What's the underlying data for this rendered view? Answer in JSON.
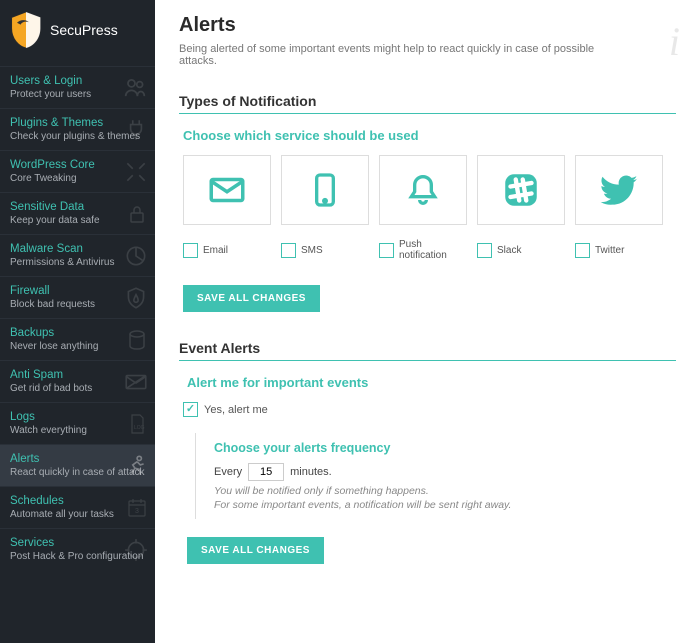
{
  "brand": "SecuPress",
  "sidebar": {
    "items": [
      {
        "title": "Users & Login",
        "sub": "Protect your users"
      },
      {
        "title": "Plugins & Themes",
        "sub": "Check your plugins & themes"
      },
      {
        "title": "WordPress Core",
        "sub": "Core Tweaking"
      },
      {
        "title": "Sensitive Data",
        "sub": "Keep your data safe"
      },
      {
        "title": "Malware Scan",
        "sub": "Permissions & Antivirus"
      },
      {
        "title": "Firewall",
        "sub": "Block bad requests"
      },
      {
        "title": "Backups",
        "sub": "Never lose anything"
      },
      {
        "title": "Anti Spam",
        "sub": "Get rid of bad bots"
      },
      {
        "title": "Logs",
        "sub": "Watch everything"
      },
      {
        "title": "Alerts",
        "sub": "React quickly in case of attack"
      },
      {
        "title": "Schedules",
        "sub": "Automate all your tasks"
      },
      {
        "title": "Services",
        "sub": "Post Hack & Pro configuration"
      }
    ]
  },
  "page": {
    "title": "Alerts",
    "desc": "Being alerted of some important events might help to react quickly in case of possible attacks."
  },
  "notif": {
    "section": "Types of Notification",
    "choose": "Choose which service should be used",
    "services": [
      "Email",
      "SMS",
      "Push notification",
      "Slack",
      "Twitter"
    ],
    "save": "SAVE ALL CHANGES"
  },
  "events": {
    "section": "Event Alerts",
    "heading": "Alert me for important events",
    "yes": "Yes, alert me",
    "freq_title": "Choose your alerts frequency",
    "every": "Every",
    "value": "15",
    "minutes": "minutes.",
    "hint1": "You will be notified only if something happens.",
    "hint2": "For some important events, a notification will be sent right away.",
    "save": "SAVE ALL CHANGES"
  }
}
